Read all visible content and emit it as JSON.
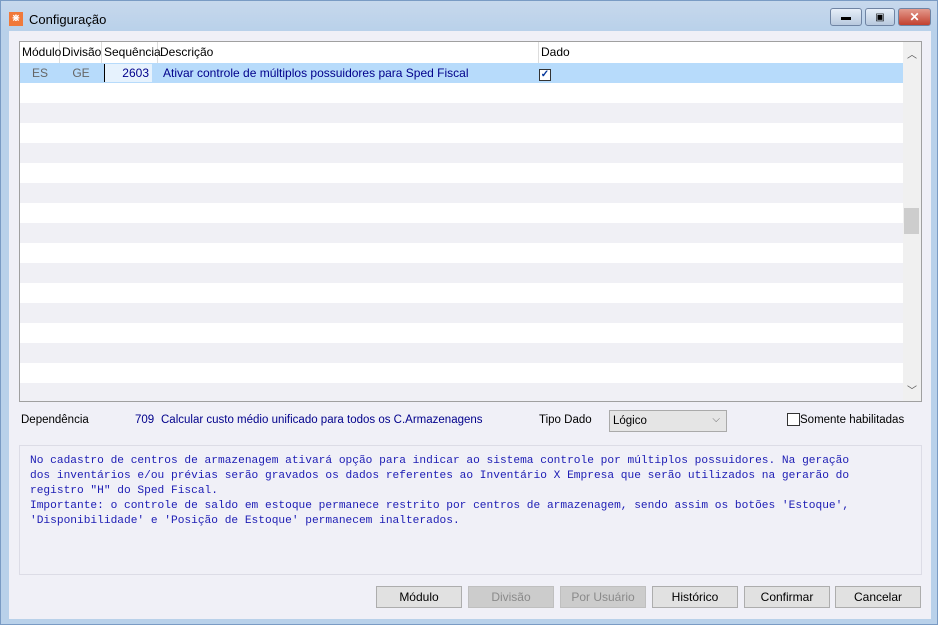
{
  "window": {
    "title": "Configuração",
    "app_icon": "app-logo-icon",
    "minimize": "minimize-icon",
    "maximize": "maximize-icon",
    "close": "close-icon"
  },
  "grid": {
    "columns": [
      "Módulo",
      "Divisão",
      "Sequência",
      "Descrição",
      "Dado"
    ],
    "rows": [
      {
        "modulo": "ES",
        "divisao": "GE",
        "sequencia": "2603",
        "descricao": "Ativar controle de múltiplos possuidores para Sped Fiscal",
        "dado": true
      }
    ]
  },
  "dependencia": {
    "label": "Dependência",
    "code": "709",
    "text": "Calcular custo médio unificado para todos os C.Armazenagens"
  },
  "tipo_dado": {
    "label": "Tipo Dado",
    "value": "Lógico"
  },
  "somente_habilitadas": {
    "label": "Somente habilitadas",
    "checked": false
  },
  "memo": "No cadastro de centros de armazenagem ativará opção para indicar ao sistema controle por múltiplos possuidores. Na geração\ndos inventários e/ou prévias serão gravados os dados referentes ao Inventário X Empresa que serão utilizados na gerarão do\nregistro \"H\" do Sped Fiscal.\nImportante: o controle de saldo em estoque permanece restrito por centros de armazenagem, sendo assim os botões 'Estoque',\n'Disponibilidade' e 'Posição de Estoque' permanecem inalterados.",
  "buttons": {
    "modulo": "Módulo",
    "divisao": "Divisão",
    "por_usuario": "Por Usuário",
    "historico": "Histórico",
    "confirmar": "Confirmar",
    "cancelar": "Cancelar"
  },
  "colors": {
    "selection": "#b7dbfb",
    "memo_text": "#1c1cb4"
  }
}
